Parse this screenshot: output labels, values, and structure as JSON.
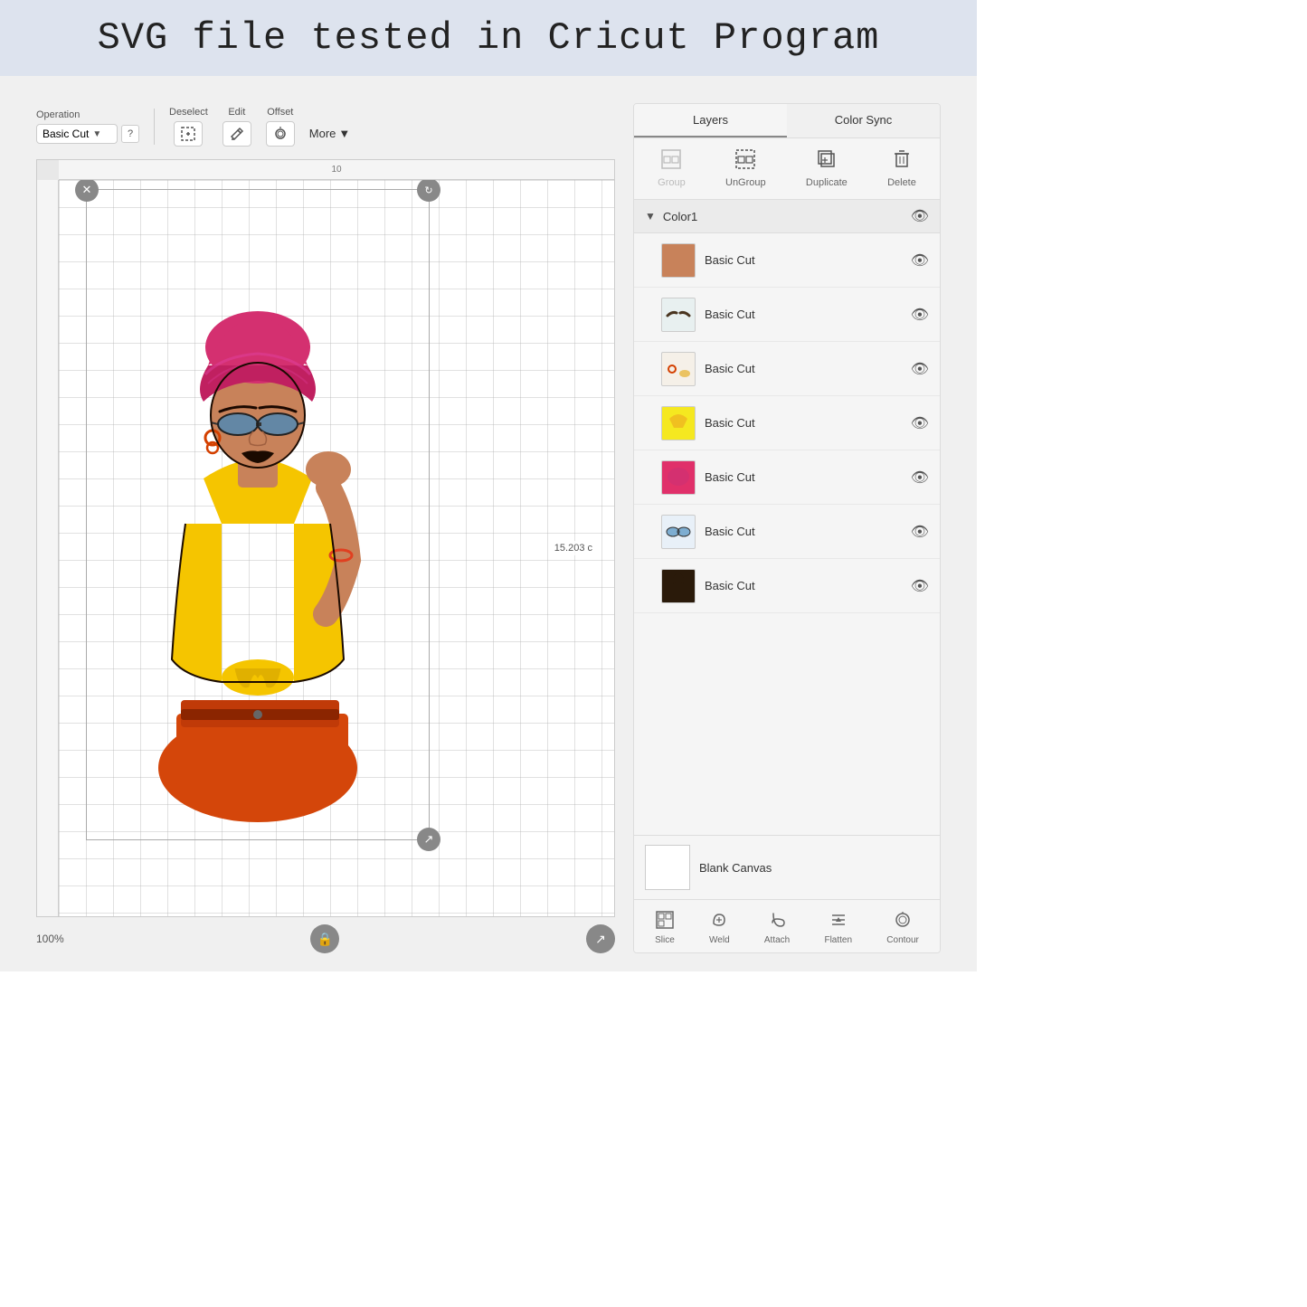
{
  "header": {
    "title": "SVG file tested in Cricut Program",
    "bg_color": "#dde3ee"
  },
  "toolbar": {
    "operation_label": "Operation",
    "operation_value": "Basic Cut",
    "help_label": "?",
    "deselect_label": "Deselect",
    "edit_label": "Edit",
    "offset_label": "Offset",
    "more_label": "More",
    "more_arrow": "▼"
  },
  "canvas": {
    "ruler_number": "10",
    "measurement": "15.203 c",
    "zoom": "100%"
  },
  "layers_panel": {
    "tab_layers": "Layers",
    "tab_color_sync": "Color Sync",
    "btn_group": "Group",
    "btn_ungroup": "UnGroup",
    "btn_duplicate": "Duplicate",
    "btn_delete": "Delete",
    "group_name": "Color1",
    "items": [
      {
        "id": 1,
        "name": "Basic Cut",
        "thumb_color": "#c8825a",
        "thumb_type": "skin"
      },
      {
        "id": 2,
        "name": "Basic Cut",
        "thumb_color": "#4a3520",
        "thumb_type": "eyebrow"
      },
      {
        "id": 3,
        "name": "Basic Cut",
        "thumb_color": "#e8c870",
        "thumb_type": "accent"
      },
      {
        "id": 4,
        "name": "Basic Cut",
        "thumb_color": "#f0c020",
        "thumb_type": "yellow"
      },
      {
        "id": 5,
        "name": "Basic Cut",
        "thumb_color": "#e0306a",
        "thumb_type": "pink"
      },
      {
        "id": 6,
        "name": "Basic Cut",
        "thumb_color": "#5090c0",
        "thumb_type": "glasses"
      },
      {
        "id": 7,
        "name": "Basic Cut",
        "thumb_color": "#2a1a0a",
        "thumb_type": "silhouette"
      }
    ],
    "blank_canvas_label": "Blank Canvas",
    "bottom_tools": [
      {
        "id": "slice",
        "label": "Slice"
      },
      {
        "id": "weld",
        "label": "Weld"
      },
      {
        "id": "attach",
        "label": "Attach"
      },
      {
        "id": "flatten",
        "label": "Flatten"
      },
      {
        "id": "contour",
        "label": "Contour"
      }
    ]
  }
}
